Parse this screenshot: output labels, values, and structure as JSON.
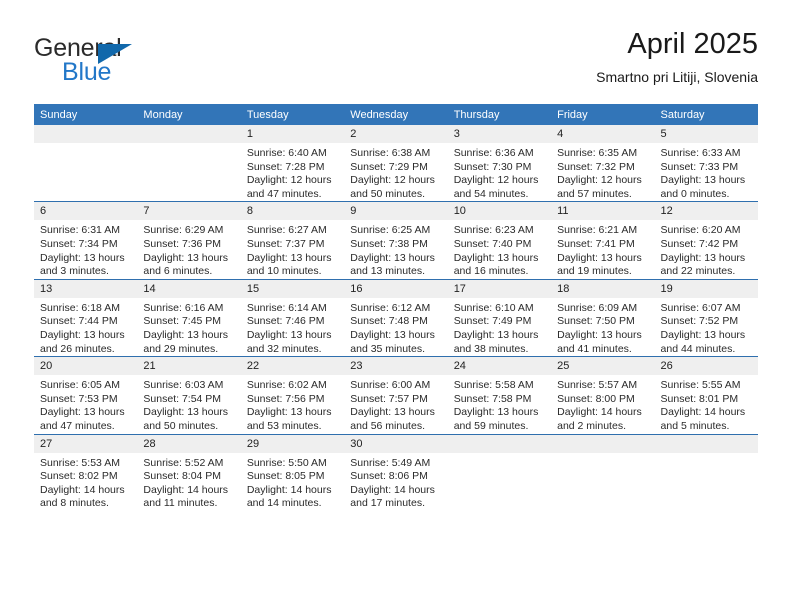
{
  "brand": {
    "name_top": "General",
    "name_bottom": "Blue",
    "triangle_color": "#1168ab",
    "top_color": "#2b2b2b",
    "bottom_color": "#2277c8"
  },
  "header": {
    "title": "April 2025",
    "subtitle": "Smartno pri Litiji, Slovenia"
  },
  "theme": {
    "header_blue": "#3275b8",
    "separator_blue": "#2f6fae",
    "daynum_bg": "#efefef",
    "text": "#2a2a2a"
  },
  "weekdays": [
    "Sunday",
    "Monday",
    "Tuesday",
    "Wednesday",
    "Thursday",
    "Friday",
    "Saturday"
  ],
  "weeks": [
    [
      {
        "day": "",
        "sunrise": "",
        "sunset": "",
        "daylight_line1": "",
        "daylight_line2": ""
      },
      {
        "day": "",
        "sunrise": "",
        "sunset": "",
        "daylight_line1": "",
        "daylight_line2": ""
      },
      {
        "day": "1",
        "sunrise": "Sunrise: 6:40 AM",
        "sunset": "Sunset: 7:28 PM",
        "daylight_line1": "Daylight: 12 hours",
        "daylight_line2": "and 47 minutes."
      },
      {
        "day": "2",
        "sunrise": "Sunrise: 6:38 AM",
        "sunset": "Sunset: 7:29 PM",
        "daylight_line1": "Daylight: 12 hours",
        "daylight_line2": "and 50 minutes."
      },
      {
        "day": "3",
        "sunrise": "Sunrise: 6:36 AM",
        "sunset": "Sunset: 7:30 PM",
        "daylight_line1": "Daylight: 12 hours",
        "daylight_line2": "and 54 minutes."
      },
      {
        "day": "4",
        "sunrise": "Sunrise: 6:35 AM",
        "sunset": "Sunset: 7:32 PM",
        "daylight_line1": "Daylight: 12 hours",
        "daylight_line2": "and 57 minutes."
      },
      {
        "day": "5",
        "sunrise": "Sunrise: 6:33 AM",
        "sunset": "Sunset: 7:33 PM",
        "daylight_line1": "Daylight: 13 hours",
        "daylight_line2": "and 0 minutes."
      }
    ],
    [
      {
        "day": "6",
        "sunrise": "Sunrise: 6:31 AM",
        "sunset": "Sunset: 7:34 PM",
        "daylight_line1": "Daylight: 13 hours",
        "daylight_line2": "and 3 minutes."
      },
      {
        "day": "7",
        "sunrise": "Sunrise: 6:29 AM",
        "sunset": "Sunset: 7:36 PM",
        "daylight_line1": "Daylight: 13 hours",
        "daylight_line2": "and 6 minutes."
      },
      {
        "day": "8",
        "sunrise": "Sunrise: 6:27 AM",
        "sunset": "Sunset: 7:37 PM",
        "daylight_line1": "Daylight: 13 hours",
        "daylight_line2": "and 10 minutes."
      },
      {
        "day": "9",
        "sunrise": "Sunrise: 6:25 AM",
        "sunset": "Sunset: 7:38 PM",
        "daylight_line1": "Daylight: 13 hours",
        "daylight_line2": "and 13 minutes."
      },
      {
        "day": "10",
        "sunrise": "Sunrise: 6:23 AM",
        "sunset": "Sunset: 7:40 PM",
        "daylight_line1": "Daylight: 13 hours",
        "daylight_line2": "and 16 minutes."
      },
      {
        "day": "11",
        "sunrise": "Sunrise: 6:21 AM",
        "sunset": "Sunset: 7:41 PM",
        "daylight_line1": "Daylight: 13 hours",
        "daylight_line2": "and 19 minutes."
      },
      {
        "day": "12",
        "sunrise": "Sunrise: 6:20 AM",
        "sunset": "Sunset: 7:42 PM",
        "daylight_line1": "Daylight: 13 hours",
        "daylight_line2": "and 22 minutes."
      }
    ],
    [
      {
        "day": "13",
        "sunrise": "Sunrise: 6:18 AM",
        "sunset": "Sunset: 7:44 PM",
        "daylight_line1": "Daylight: 13 hours",
        "daylight_line2": "and 26 minutes."
      },
      {
        "day": "14",
        "sunrise": "Sunrise: 6:16 AM",
        "sunset": "Sunset: 7:45 PM",
        "daylight_line1": "Daylight: 13 hours",
        "daylight_line2": "and 29 minutes."
      },
      {
        "day": "15",
        "sunrise": "Sunrise: 6:14 AM",
        "sunset": "Sunset: 7:46 PM",
        "daylight_line1": "Daylight: 13 hours",
        "daylight_line2": "and 32 minutes."
      },
      {
        "day": "16",
        "sunrise": "Sunrise: 6:12 AM",
        "sunset": "Sunset: 7:48 PM",
        "daylight_line1": "Daylight: 13 hours",
        "daylight_line2": "and 35 minutes."
      },
      {
        "day": "17",
        "sunrise": "Sunrise: 6:10 AM",
        "sunset": "Sunset: 7:49 PM",
        "daylight_line1": "Daylight: 13 hours",
        "daylight_line2": "and 38 minutes."
      },
      {
        "day": "18",
        "sunrise": "Sunrise: 6:09 AM",
        "sunset": "Sunset: 7:50 PM",
        "daylight_line1": "Daylight: 13 hours",
        "daylight_line2": "and 41 minutes."
      },
      {
        "day": "19",
        "sunrise": "Sunrise: 6:07 AM",
        "sunset": "Sunset: 7:52 PM",
        "daylight_line1": "Daylight: 13 hours",
        "daylight_line2": "and 44 minutes."
      }
    ],
    [
      {
        "day": "20",
        "sunrise": "Sunrise: 6:05 AM",
        "sunset": "Sunset: 7:53 PM",
        "daylight_line1": "Daylight: 13 hours",
        "daylight_line2": "and 47 minutes."
      },
      {
        "day": "21",
        "sunrise": "Sunrise: 6:03 AM",
        "sunset": "Sunset: 7:54 PM",
        "daylight_line1": "Daylight: 13 hours",
        "daylight_line2": "and 50 minutes."
      },
      {
        "day": "22",
        "sunrise": "Sunrise: 6:02 AM",
        "sunset": "Sunset: 7:56 PM",
        "daylight_line1": "Daylight: 13 hours",
        "daylight_line2": "and 53 minutes."
      },
      {
        "day": "23",
        "sunrise": "Sunrise: 6:00 AM",
        "sunset": "Sunset: 7:57 PM",
        "daylight_line1": "Daylight: 13 hours",
        "daylight_line2": "and 56 minutes."
      },
      {
        "day": "24",
        "sunrise": "Sunrise: 5:58 AM",
        "sunset": "Sunset: 7:58 PM",
        "daylight_line1": "Daylight: 13 hours",
        "daylight_line2": "and 59 minutes."
      },
      {
        "day": "25",
        "sunrise": "Sunrise: 5:57 AM",
        "sunset": "Sunset: 8:00 PM",
        "daylight_line1": "Daylight: 14 hours",
        "daylight_line2": "and 2 minutes."
      },
      {
        "day": "26",
        "sunrise": "Sunrise: 5:55 AM",
        "sunset": "Sunset: 8:01 PM",
        "daylight_line1": "Daylight: 14 hours",
        "daylight_line2": "and 5 minutes."
      }
    ],
    [
      {
        "day": "27",
        "sunrise": "Sunrise: 5:53 AM",
        "sunset": "Sunset: 8:02 PM",
        "daylight_line1": "Daylight: 14 hours",
        "daylight_line2": "and 8 minutes."
      },
      {
        "day": "28",
        "sunrise": "Sunrise: 5:52 AM",
        "sunset": "Sunset: 8:04 PM",
        "daylight_line1": "Daylight: 14 hours",
        "daylight_line2": "and 11 minutes."
      },
      {
        "day": "29",
        "sunrise": "Sunrise: 5:50 AM",
        "sunset": "Sunset: 8:05 PM",
        "daylight_line1": "Daylight: 14 hours",
        "daylight_line2": "and 14 minutes."
      },
      {
        "day": "30",
        "sunrise": "Sunrise: 5:49 AM",
        "sunset": "Sunset: 8:06 PM",
        "daylight_line1": "Daylight: 14 hours",
        "daylight_line2": "and 17 minutes."
      },
      {
        "day": "",
        "sunrise": "",
        "sunset": "",
        "daylight_line1": "",
        "daylight_line2": ""
      },
      {
        "day": "",
        "sunrise": "",
        "sunset": "",
        "daylight_line1": "",
        "daylight_line2": ""
      },
      {
        "day": "",
        "sunrise": "",
        "sunset": "",
        "daylight_line1": "",
        "daylight_line2": ""
      }
    ]
  ]
}
